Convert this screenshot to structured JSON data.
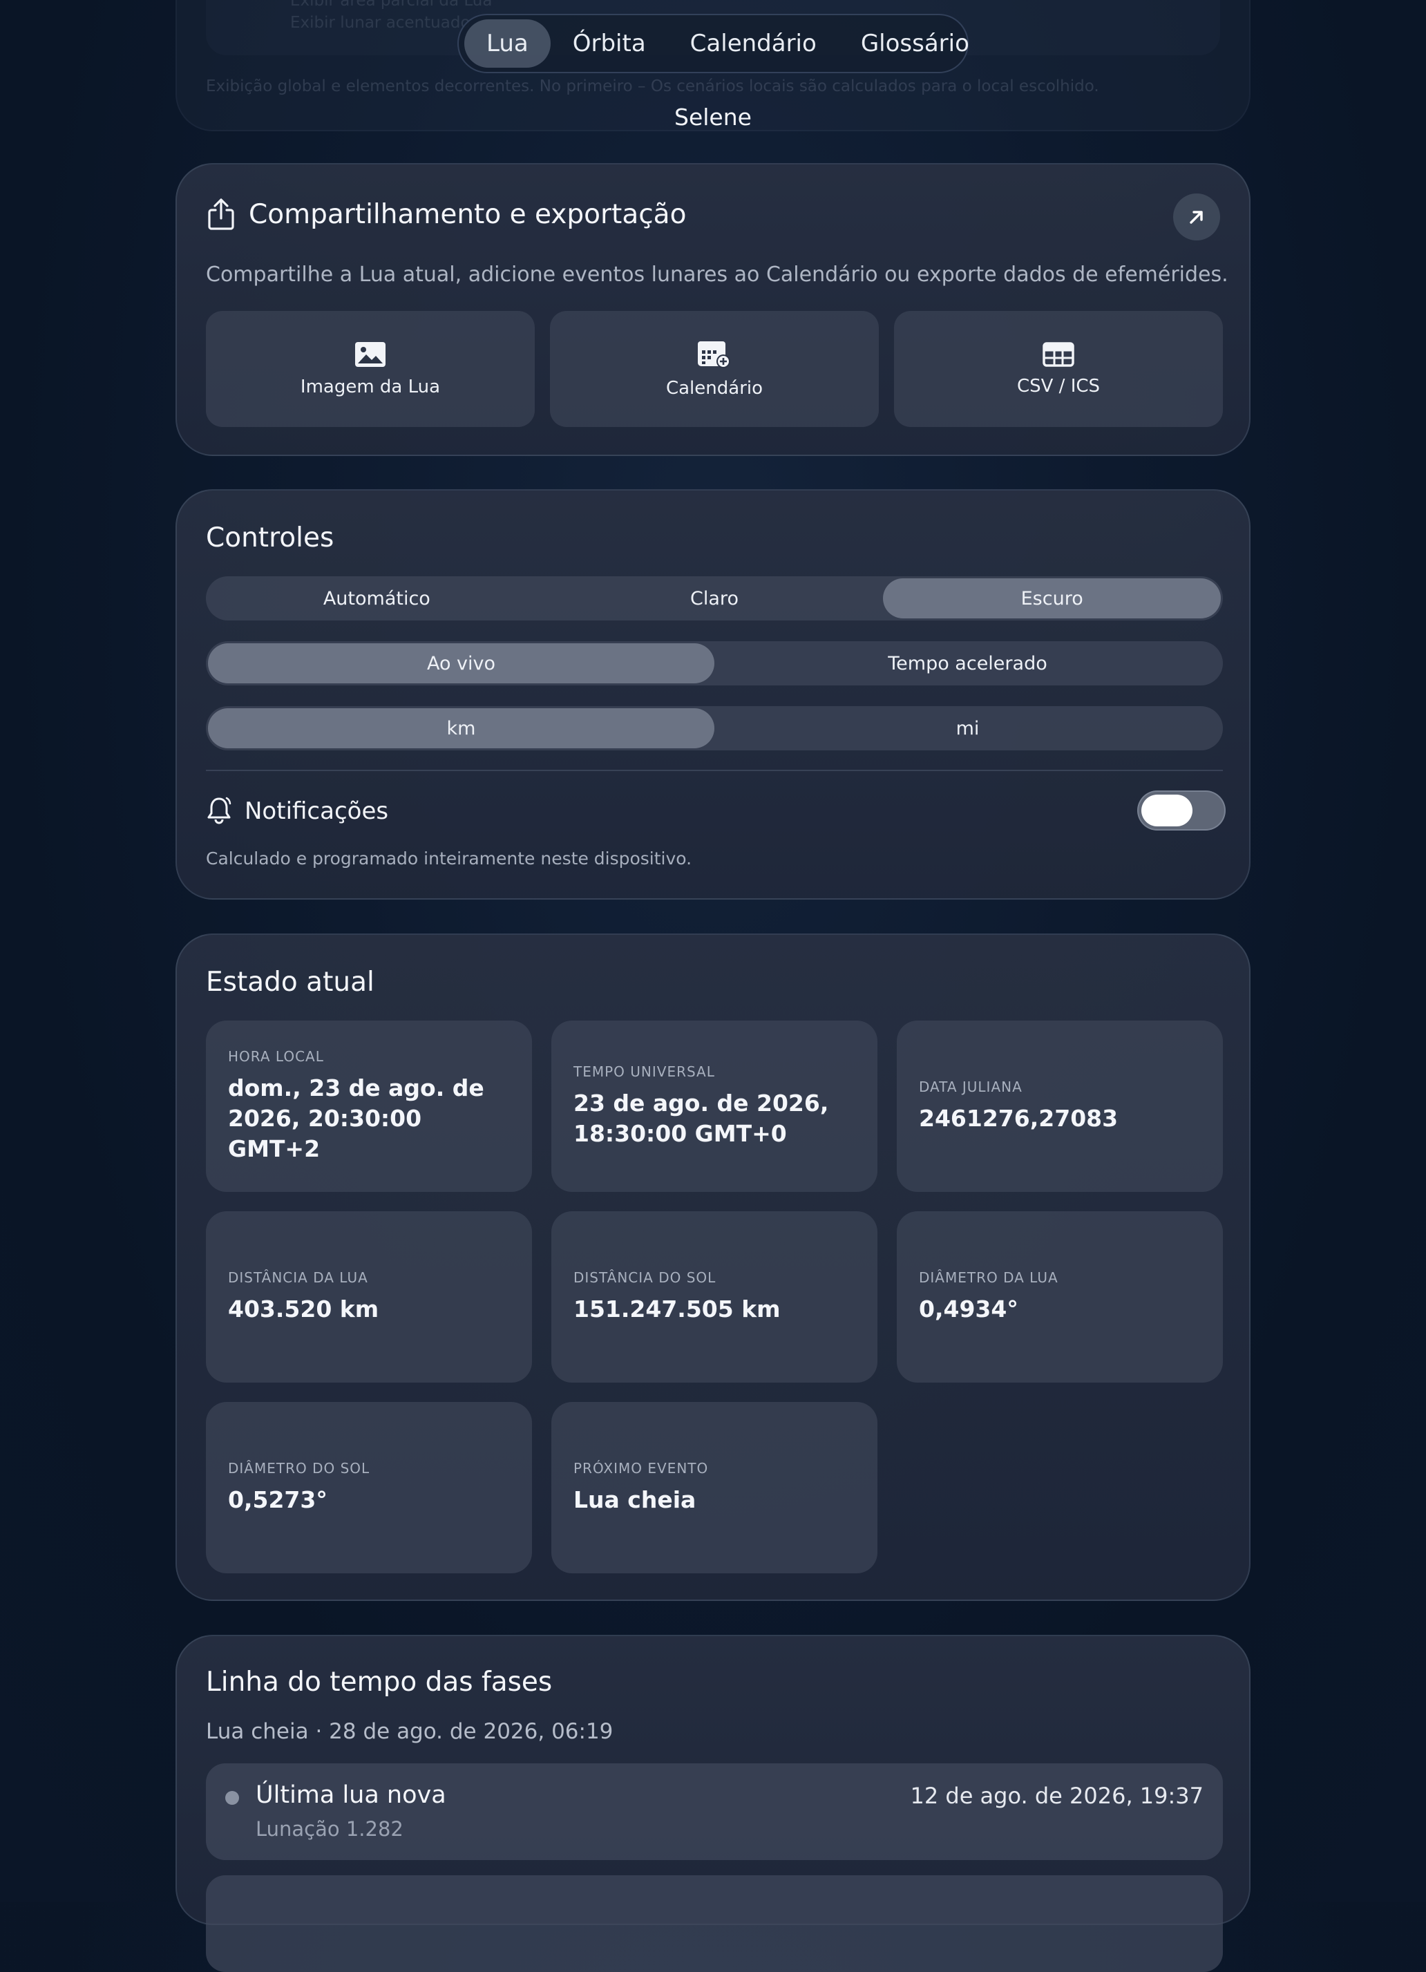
{
  "ghost": {
    "line1": "Exibir área parcial da Lua",
    "line2": "Exibir lunar acentuado",
    "footer": "Exibição global e elementos decorrentes. No primeiro – Os cenários locais são calculados para o local escolhido."
  },
  "nav": {
    "tabs": [
      "Lua",
      "Órbita",
      "Calendário",
      "Glossário"
    ],
    "active": "Lua"
  },
  "app": {
    "title": "Selene"
  },
  "share": {
    "title": "Compartilhamento e exportação",
    "description": "Compartilhe a Lua atual, adicione eventos lunares ao Calendário ou exporte dados de efemérides.",
    "buttons": [
      {
        "label": "Imagem da Lua",
        "icon": "image-icon"
      },
      {
        "label": "Calendário",
        "icon": "calendar-add-icon"
      },
      {
        "label": "CSV / ICS",
        "icon": "table-icon"
      }
    ],
    "open_icon": "arrow-up-right-icon"
  },
  "controls": {
    "title": "Controles",
    "appearance": {
      "options": [
        "Automático",
        "Claro",
        "Escuro"
      ],
      "selected": "Escuro"
    },
    "time_mode": {
      "options": [
        "Ao vivo",
        "Tempo acelerado"
      ],
      "selected": "Ao vivo"
    },
    "units": {
      "options": [
        "km",
        "mi"
      ],
      "selected": "km"
    },
    "notifications": {
      "label": "Notificações",
      "enabled": false,
      "description": "Calculado e programado inteiramente neste dispositivo."
    }
  },
  "state": {
    "title": "Estado atual",
    "tiles": [
      {
        "label": "Hora local",
        "value": "dom., 23 de ago. de 2026, 20:30:00 GMT+2"
      },
      {
        "label": "Tempo universal",
        "value": "23 de ago. de 2026, 18:30:00 GMT+0"
      },
      {
        "label": "Data juliana",
        "value": "2461276,27083"
      },
      {
        "label": "Distância da Lua",
        "value": "403.520 km"
      },
      {
        "label": "Distância do Sol",
        "value": "151.247.505 km"
      },
      {
        "label": "Diâmetro da Lua",
        "value": "0,4934°"
      },
      {
        "label": "Diâmetro do Sol",
        "value": "0,5273°"
      },
      {
        "label": "Próximo evento",
        "value": "Lua cheia"
      }
    ]
  },
  "timeline": {
    "title": "Linha do tempo das fases",
    "subtitle": "Lua cheia · 28 de ago. de 2026, 06:19",
    "items": [
      {
        "title": "Última lua nova",
        "detail": "Lunação 1.282",
        "date": "12 de ago. de 2026, 19:37"
      }
    ]
  }
}
